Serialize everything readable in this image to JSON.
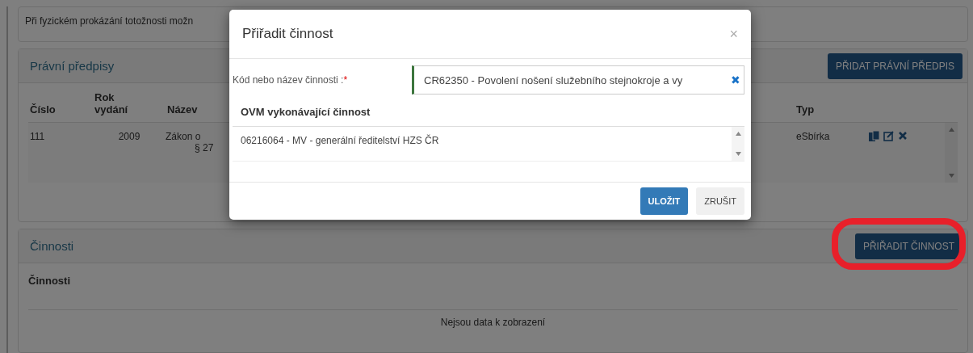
{
  "info_panel": {
    "text": "Při fyzickém prokázání totožnosti možn"
  },
  "legal_panel": {
    "title": "Právní předpisy",
    "add_button": "PŘIDAT PRÁVNÍ PŘEDPIS",
    "columns": [
      {
        "lines": [
          "Číslo"
        ]
      },
      {
        "lines": [
          "Rok",
          "vydání"
        ]
      },
      {
        "lines": [
          "Název"
        ]
      },
      {
        "lines": [
          "Typ"
        ]
      }
    ],
    "rows": [
      {
        "number": "111",
        "year": "2009",
        "name_lines": [
          "Zákon o",
          "§ 27"
        ],
        "type": "eSbírka"
      }
    ]
  },
  "activities_panel": {
    "title": "Činnosti",
    "assign_button": "PŘIŘADIT ČINNOST",
    "highlighted": true,
    "table_heading": "Činnosti",
    "empty_text": "Nejsou data k zobrazení"
  },
  "dialog": {
    "title": "Přiřadit činnost",
    "close": "×",
    "field": {
      "label": "Kód nebo název činnosti :",
      "required_mark": "*",
      "value": "CR62350 - Povolení nošení služebního stejnokroje a vy",
      "clear": "✖"
    },
    "list_heading": "OVM vykonávající činnost",
    "list_items": [
      "06216064 - MV - generální ředitelství HZS ČR"
    ],
    "buttons": [
      {
        "label": "ULOŽIT",
        "kind": "primary"
      },
      {
        "label": "ZRUŠIT",
        "kind": "secondary"
      }
    ]
  }
}
